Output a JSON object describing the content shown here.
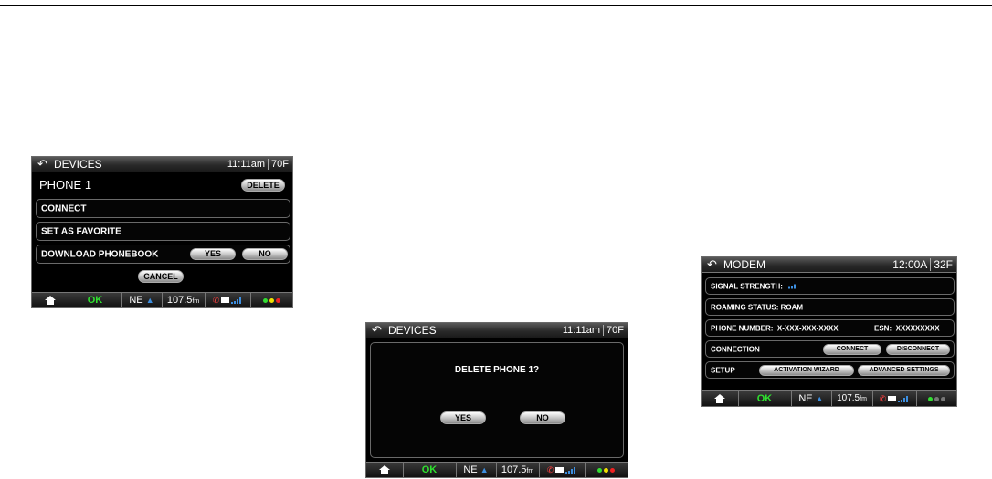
{
  "screens": {
    "devices_phone": {
      "title": "DEVICES",
      "time": "11:11am",
      "temp": "70F",
      "device_name": "PHONE 1",
      "delete_label": "DELETE",
      "rows": {
        "connect": "CONNECT",
        "favorite": "SET AS FAVORITE",
        "phonebook": "DOWNLOAD PHONEBOOK"
      },
      "yes_label": "YES",
      "no_label": "NO",
      "cancel_label": "CANCEL"
    },
    "devices_delete": {
      "title": "DEVICES",
      "time": "11:11am",
      "temp": "70F",
      "prompt": "DELETE PHONE 1?",
      "yes_label": "YES",
      "no_label": "NO"
    },
    "modem": {
      "title": "MODEM",
      "time": "12:00A",
      "temp": "32F",
      "signal_label": "SIGNAL STRENGTH:",
      "roaming_label": "ROAMING STATUS:",
      "roaming_value": "ROAM",
      "phone_label": "PHONE NUMBER:",
      "phone_value": "X-XXX-XXX-XXXX",
      "esn_label": "ESN:",
      "esn_value": "XXXXXXXXX",
      "connection_label": "CONNECTION",
      "connect_label": "CONNECT",
      "disconnect_label": "DISCONNECT",
      "setup_label": "SETUP",
      "wizard_label": "ACTIVATION WIZARD",
      "advanced_label": "ADVANCED SETTINGS"
    }
  },
  "statusbar": {
    "ok": "OK",
    "heading": "NE",
    "frequency": "107.5",
    "band": "fm"
  },
  "colors": {
    "ok_green": "#2fe02f",
    "heading_blue": "#3d8fe0",
    "light_green": "#33dd33",
    "light_yellow": "#f0e000",
    "light_red": "#ee2222",
    "light_gray": "#777777"
  },
  "icons": [
    "back-arrow-icon",
    "home-icon",
    "phone-icon",
    "message-icon",
    "signal-icon"
  ]
}
